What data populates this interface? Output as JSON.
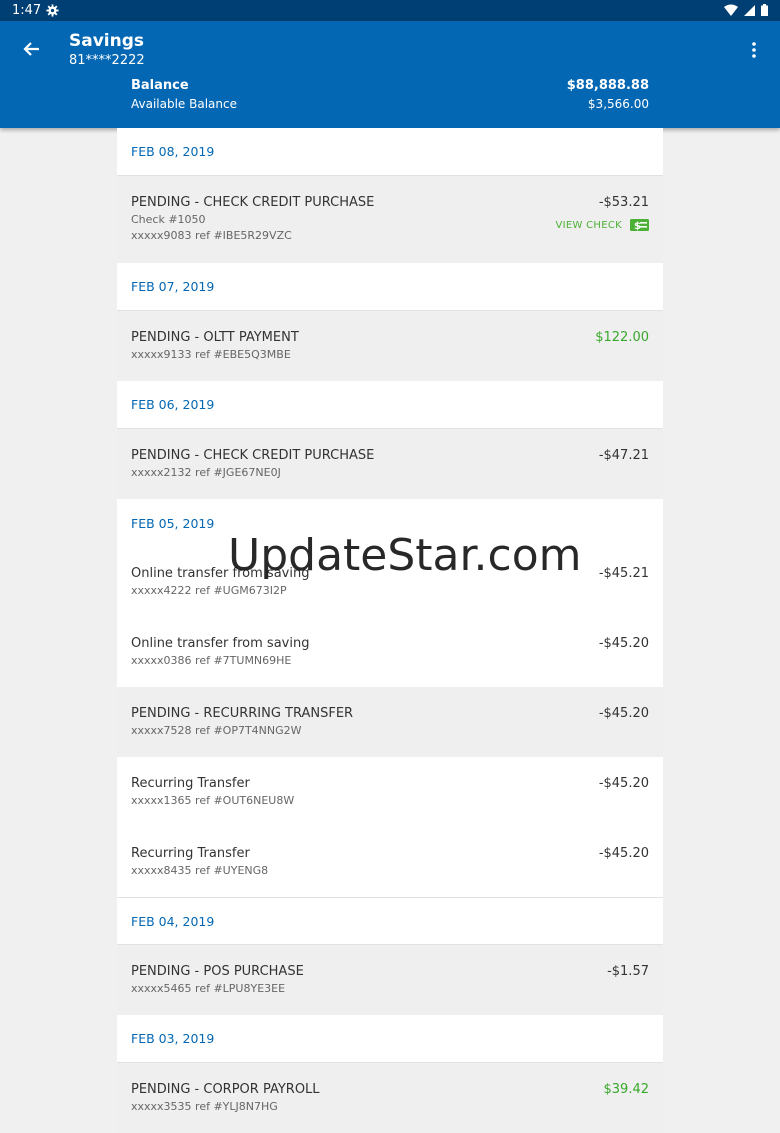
{
  "status": {
    "time": "1:47"
  },
  "header": {
    "account_name": "Savings",
    "account_number": "81****2222",
    "balance_label": "Balance",
    "balance_value": "$88,888.88",
    "available_label": "Available Balance",
    "available_value": "$3,566.00"
  },
  "colors": {
    "brand": "#0467b3",
    "positive": "#38a82a"
  },
  "groups": [
    {
      "date": "FEB 08, 2019",
      "txns": [
        {
          "title": "PENDING - CHECK CREDIT PURCHASE",
          "check": "Check #1050",
          "ref": "xxxxx9083 ref #IBE5R29VZC",
          "amount": "-$53.21",
          "positive": false,
          "pending": true,
          "view_check": "VIEW CHECK"
        }
      ]
    },
    {
      "date": "FEB 07, 2019",
      "txns": [
        {
          "title": "PENDING - OLTT PAYMENT",
          "ref": "xxxxx9133 ref #EBE5Q3MBE",
          "amount": "$122.00",
          "positive": true,
          "pending": true
        }
      ]
    },
    {
      "date": "FEB 06, 2019",
      "txns": [
        {
          "title": "PENDING - CHECK CREDIT PURCHASE",
          "ref": "xxxxx2132 ref #JGE67NE0J",
          "amount": "-$47.21",
          "positive": false,
          "pending": true
        }
      ]
    },
    {
      "date": "FEB 05, 2019",
      "txns": [
        {
          "title": "Online transfer from saving",
          "ref": "xxxxx4222 ref #UGM673I2P",
          "amount": "-$45.21",
          "positive": false,
          "pending": false
        },
        {
          "title": "Online transfer from saving",
          "ref": "xxxxx0386 ref #7TUMN69HE",
          "amount": "-$45.20",
          "positive": false,
          "pending": false
        },
        {
          "title": "PENDING - RECURRING TRANSFER",
          "ref": "xxxxx7528 ref #OP7T4NNG2W",
          "amount": "-$45.20",
          "positive": false,
          "pending": true
        },
        {
          "title": "Recurring Transfer",
          "ref": "xxxxx1365 ref #OUT6NEU8W",
          "amount": "-$45.20",
          "positive": false,
          "pending": false
        },
        {
          "title": "Recurring Transfer",
          "ref": "xxxxx8435 ref #UYENG8",
          "amount": "-$45.20",
          "positive": false,
          "pending": false
        }
      ]
    },
    {
      "date": "FEB 04, 2019",
      "txns": [
        {
          "title": "PENDING - POS PURCHASE",
          "ref": "xxxxx5465 ref #LPU8YE3EE",
          "amount": "-$1.57",
          "positive": false,
          "pending": true
        }
      ]
    },
    {
      "date": "FEB 03, 2019",
      "txns": [
        {
          "title": "PENDING - CORPOR PAYROLL",
          "ref": "xxxxx3535 ref #YLJ8N7HG",
          "amount": "$39.42",
          "positive": true,
          "pending": true
        }
      ]
    }
  ],
  "watermark": "UpdateStar.com"
}
